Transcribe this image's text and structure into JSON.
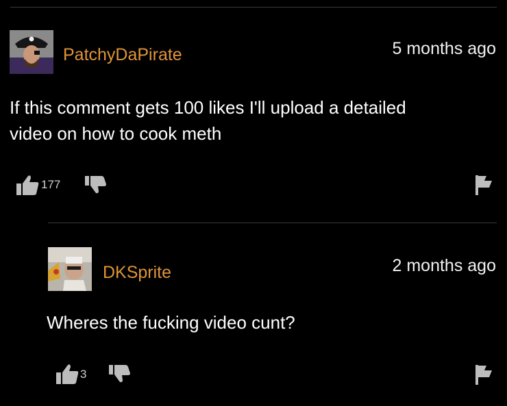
{
  "comments": [
    {
      "username": "PatchyDaPirate",
      "time": "5 months ago",
      "text_lines": [
        "If this comment gets 100 likes I'll upload a detailed",
        "video on how to cook meth"
      ],
      "likes": "177",
      "icons": {
        "like": "thumbs-up-icon",
        "dislike": "thumbs-down-icon",
        "flag": "flag-icon"
      }
    },
    {
      "username": "DKSprite",
      "time": "2 months ago",
      "text_lines": [
        "Wheres the fucking video cunt?"
      ],
      "likes": "3",
      "icons": {
        "like": "thumbs-up-icon",
        "dislike": "thumbs-down-icon",
        "flag": "flag-icon"
      }
    }
  ],
  "colors": {
    "background": "#000000",
    "username": "#e0953a",
    "text": "#ffffff",
    "divider": "#3a3a3a"
  }
}
